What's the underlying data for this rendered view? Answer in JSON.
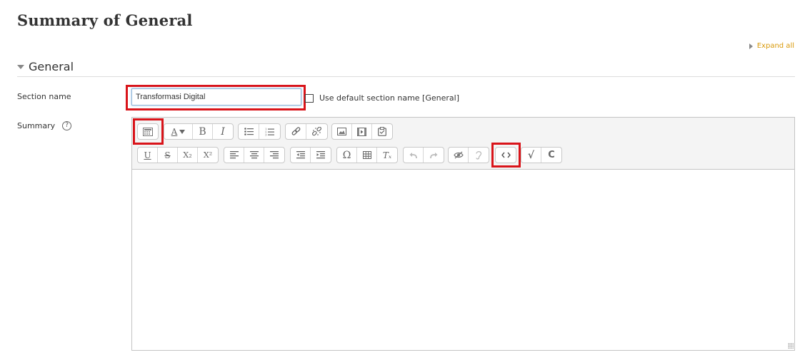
{
  "page": {
    "title": "Summary of General",
    "expand_all": "Expand all"
  },
  "section": {
    "title": "General"
  },
  "form": {
    "section_name_label": "Section name",
    "section_name_value": "Transformasi Digital",
    "use_default_label": "Use default section name [General]",
    "use_default_checked": false,
    "summary_label": "Summary",
    "help_glyph": "?"
  },
  "toolbar": {
    "font_glyph": "A",
    "bold": "B",
    "italic": "I",
    "underline": "U",
    "strike": "S",
    "subscript": "X₂",
    "superscript": "X²",
    "special_chars": "Ω",
    "clear_format": "Tₓ",
    "equation": "√",
    "chemistry": "C"
  },
  "colors": {
    "highlight": "#d9141a",
    "link": "#d99a0b"
  },
  "icons": [
    "toggle-toolbar-icon",
    "font-style-icon",
    "bold-icon",
    "italic-icon",
    "unordered-list-icon",
    "ordered-list-icon",
    "link-icon",
    "unlink-icon",
    "image-icon",
    "media-icon",
    "manage-files-icon",
    "underline-icon",
    "strikethrough-icon",
    "subscript-icon",
    "superscript-icon",
    "align-left-icon",
    "align-center-icon",
    "align-right-icon",
    "outdent-icon",
    "indent-icon",
    "special-chars-icon",
    "table-icon",
    "clear-formatting-icon",
    "undo-icon",
    "redo-icon",
    "accessibility-checker-icon",
    "screenreader-helper-icon",
    "html-source-icon",
    "equation-icon",
    "chemistry-icon"
  ]
}
